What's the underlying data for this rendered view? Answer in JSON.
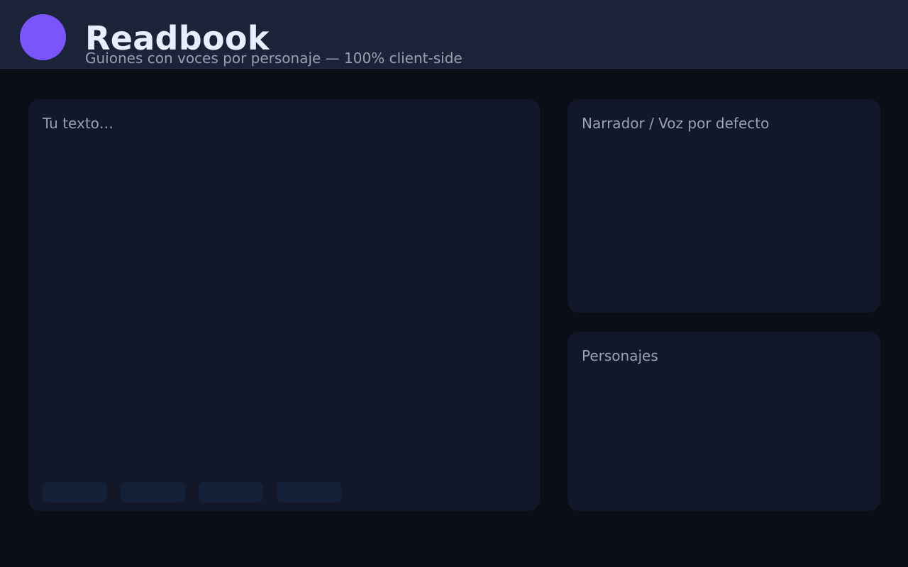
{
  "app": {
    "title": "Readbook",
    "subtitle": "Guiones con voces por personaje — 100% client-side"
  },
  "editor": {
    "placeholder": "Tu texto…",
    "toolbar_buttons": [
      "",
      "",
      "",
      ""
    ]
  },
  "narrator": {
    "label": "Narrador / Voz por defecto"
  },
  "characters": {
    "label": "Personajes"
  },
  "colors": {
    "accent": "#7b55fc",
    "background": "#0b0e16",
    "header": "#1b2339",
    "panel": "#121829"
  }
}
